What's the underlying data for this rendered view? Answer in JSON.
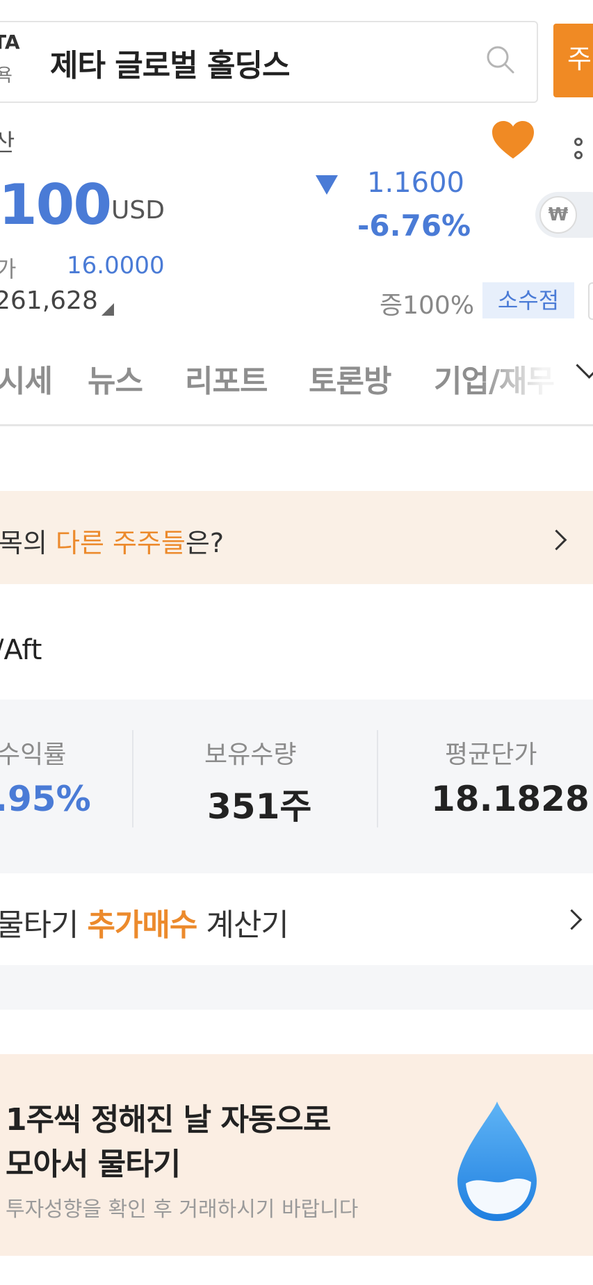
{
  "header": {
    "ticker": "TA",
    "market": "욕",
    "title": "제타 글로벌 홀딩스",
    "order_label": "주"
  },
  "quote": {
    "region_label": "산",
    "price": "100",
    "currency": "USD",
    "change_abs": "1.1600",
    "change_pct": "-6.76%",
    "low_label": "가",
    "low_value": "16.0000",
    "volume": "261,628",
    "margin_rate": "증100%",
    "fraction_badge": "소수점",
    "toggle_icon": "₩"
  },
  "tabs": [
    "시세",
    "뉴스",
    "리포트",
    "토론방",
    "기업/재무"
  ],
  "community_banner": {
    "prefix": "목의 ",
    "highlight": "다른 주주들",
    "suffix": "은?"
  },
  "account": {
    "id": "/Aft",
    "stats": [
      {
        "label": "수익률",
        "value": ".95%"
      },
      {
        "label": "보유수량",
        "value": "351주"
      },
      {
        "label": "평균단가",
        "value": "18.1828"
      }
    ]
  },
  "calculator": {
    "prefix": "물타기 ",
    "highlight": "추가매수",
    "suffix": " 계산기"
  },
  "promo": {
    "line1": "1주씩 정해진 날 자동으로",
    "line2": "모아서 물타기",
    "subtitle": "투자성향을 확인 후 거래하시기 바랍니다"
  },
  "colors": {
    "accent_orange": "#f08a24",
    "price_blue": "#4a7bd6"
  },
  "icons": [
    "search-icon",
    "heart-icon",
    "more-icon",
    "chevron-down-icon",
    "chevron-right-icon",
    "water-drop-icon"
  ]
}
